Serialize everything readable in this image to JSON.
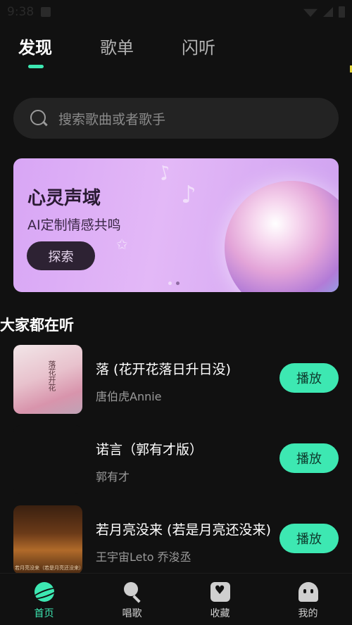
{
  "status_bar": {
    "time": "9:38"
  },
  "top_tabs": [
    {
      "label": "发现",
      "active": true
    },
    {
      "label": "歌单",
      "active": false
    },
    {
      "label": "闪听",
      "active": false
    }
  ],
  "search": {
    "placeholder": "搜索歌曲或者歌手"
  },
  "banner": {
    "title": "心灵声域",
    "subtitle": "AI定制情感共鸣",
    "button": "探索",
    "page_count": 2,
    "active_page": 2
  },
  "section": {
    "title": "大家都在听"
  },
  "songs": [
    {
      "title": "落 (花开花落日升日没)",
      "artist": "唐伯虎Annie",
      "action": "播放",
      "cover_text": "落花开花"
    },
    {
      "title": "诺言（郭有才版）",
      "artist": "郭有才",
      "action": "播放"
    },
    {
      "title": "若月亮没来 (若是月亮还没来)",
      "artist": "王宇宙Leto 乔浚丞",
      "action": "播放",
      "cover_text": "若月亮没来（若是月亮还没来）"
    }
  ],
  "bottom_nav": [
    {
      "label": "首页",
      "icon": "planet-icon",
      "active": true
    },
    {
      "label": "唱歌",
      "icon": "microphone-icon",
      "active": false
    },
    {
      "label": "收藏",
      "icon": "favorites-icon",
      "active": false
    },
    {
      "label": "我的",
      "icon": "ghost-icon",
      "active": false
    }
  ],
  "colors": {
    "accent": "#3de8b2",
    "background": "#111111",
    "banner": "#d8a6f5"
  }
}
